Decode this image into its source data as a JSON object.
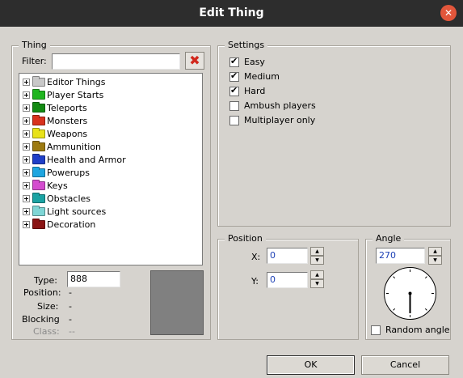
{
  "window": {
    "title": "Edit Thing"
  },
  "thing_group": {
    "legend": "Thing",
    "filter_label": "Filter:",
    "filter_value": "",
    "tree": [
      {
        "label": "Editor Things",
        "color": "#c8c8c8"
      },
      {
        "label": "Player Starts",
        "color": "#1fb51f"
      },
      {
        "label": "Teleports",
        "color": "#138a13"
      },
      {
        "label": "Monsters",
        "color": "#d8321e"
      },
      {
        "label": "Weapons",
        "color": "#e8e21a"
      },
      {
        "label": "Ammunition",
        "color": "#9c7a12"
      },
      {
        "label": "Health and Armor",
        "color": "#1f3fc8"
      },
      {
        "label": "Powerups",
        "color": "#1fa6e0"
      },
      {
        "label": "Keys",
        "color": "#d44ccf"
      },
      {
        "label": "Obstacles",
        "color": "#1aa3a3"
      },
      {
        "label": "Light sources",
        "color": "#7fd6d6"
      },
      {
        "label": "Decoration",
        "color": "#8a1414"
      }
    ],
    "type_label": "Type:",
    "type_value": "888",
    "position_label": "Position:",
    "position_value": "-",
    "size_label": "Size:",
    "size_value": "-",
    "blocking_label": "Blocking",
    "blocking_value": "-",
    "class_label": "Class:",
    "class_value": "--"
  },
  "settings": {
    "legend": "Settings",
    "options": [
      {
        "label": "Easy",
        "checked": true
      },
      {
        "label": "Medium",
        "checked": true
      },
      {
        "label": "Hard",
        "checked": true
      },
      {
        "label": "Ambush players",
        "checked": false
      },
      {
        "label": "Multiplayer only",
        "checked": false
      }
    ]
  },
  "position": {
    "legend": "Position",
    "x_label": "X:",
    "x_value": "0",
    "y_label": "Y:",
    "y_value": "0"
  },
  "angle": {
    "legend": "Angle",
    "value": "270",
    "random_label": "Random angle",
    "random_checked": false
  },
  "buttons": {
    "ok": "OK",
    "cancel": "Cancel"
  }
}
